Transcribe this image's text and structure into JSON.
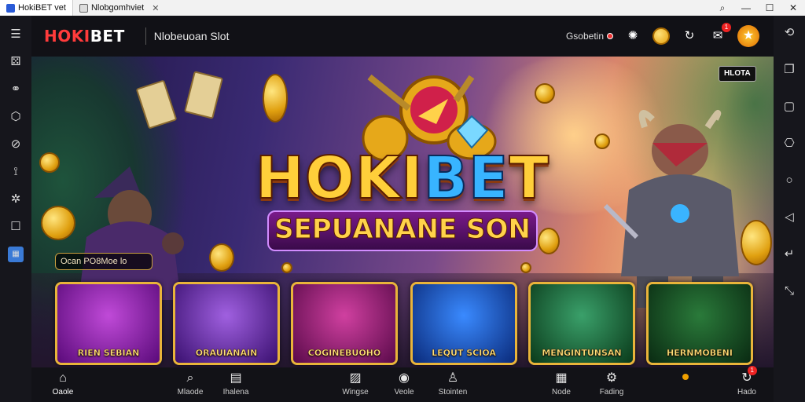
{
  "window": {
    "tabs": [
      {
        "label": "HokiBET vet",
        "active": true
      },
      {
        "label": "Nlobgomhviet",
        "active": false
      }
    ],
    "controls": [
      "search-icon",
      "minimize-icon",
      "maximize-icon",
      "close-icon"
    ]
  },
  "header": {
    "logo_part1": "HOKI",
    "logo_part2": "BET",
    "app_title": "Nlobeuoan Slot",
    "status_text": "Gsobetin",
    "notification_count": "1"
  },
  "banner": {
    "title_part1": "HOKI",
    "title_part2": "BE",
    "title_part3": "T",
    "subtitle": "SEPUANANE SON",
    "promo_pill": "Ocan PO8Moe lo",
    "corner_badge": "HLOTA"
  },
  "games": [
    {
      "label": "RIEN SEBIAN",
      "bg": "#7a1a9a"
    },
    {
      "label": "ORAUIANAIN",
      "bg": "#6a2aa0"
    },
    {
      "label": "COGINEBUOHO",
      "bg": "#8a1a6a"
    },
    {
      "label": "LEQUT SCIOA",
      "bg": "#1a4aaa"
    },
    {
      "label": "MENGINTUNSAN",
      "bg": "#1a6a3a"
    },
    {
      "label": "HERNMOBENI",
      "bg": "#1a5a2a"
    }
  ],
  "bottom_nav": [
    {
      "label": "Oaole",
      "icon": "home-icon"
    },
    {
      "label": "Mlaode",
      "icon": "search-icon"
    },
    {
      "label": "Ihalena",
      "icon": "calendar-icon"
    },
    {
      "label": "Wingse",
      "icon": "gallery-icon"
    },
    {
      "label": "Veole",
      "icon": "profile-icon"
    },
    {
      "label": "Stointen",
      "icon": "group-icon"
    },
    {
      "label": "Node",
      "icon": "grid-icon"
    },
    {
      "label": "Fading",
      "icon": "chat-icon"
    },
    {
      "label": "Hado",
      "icon": "user-icon",
      "badge": "1"
    }
  ],
  "colors": {
    "accent": "#ff3b3b",
    "gold": "#ffcf3a",
    "blue": "#38b4ff"
  }
}
